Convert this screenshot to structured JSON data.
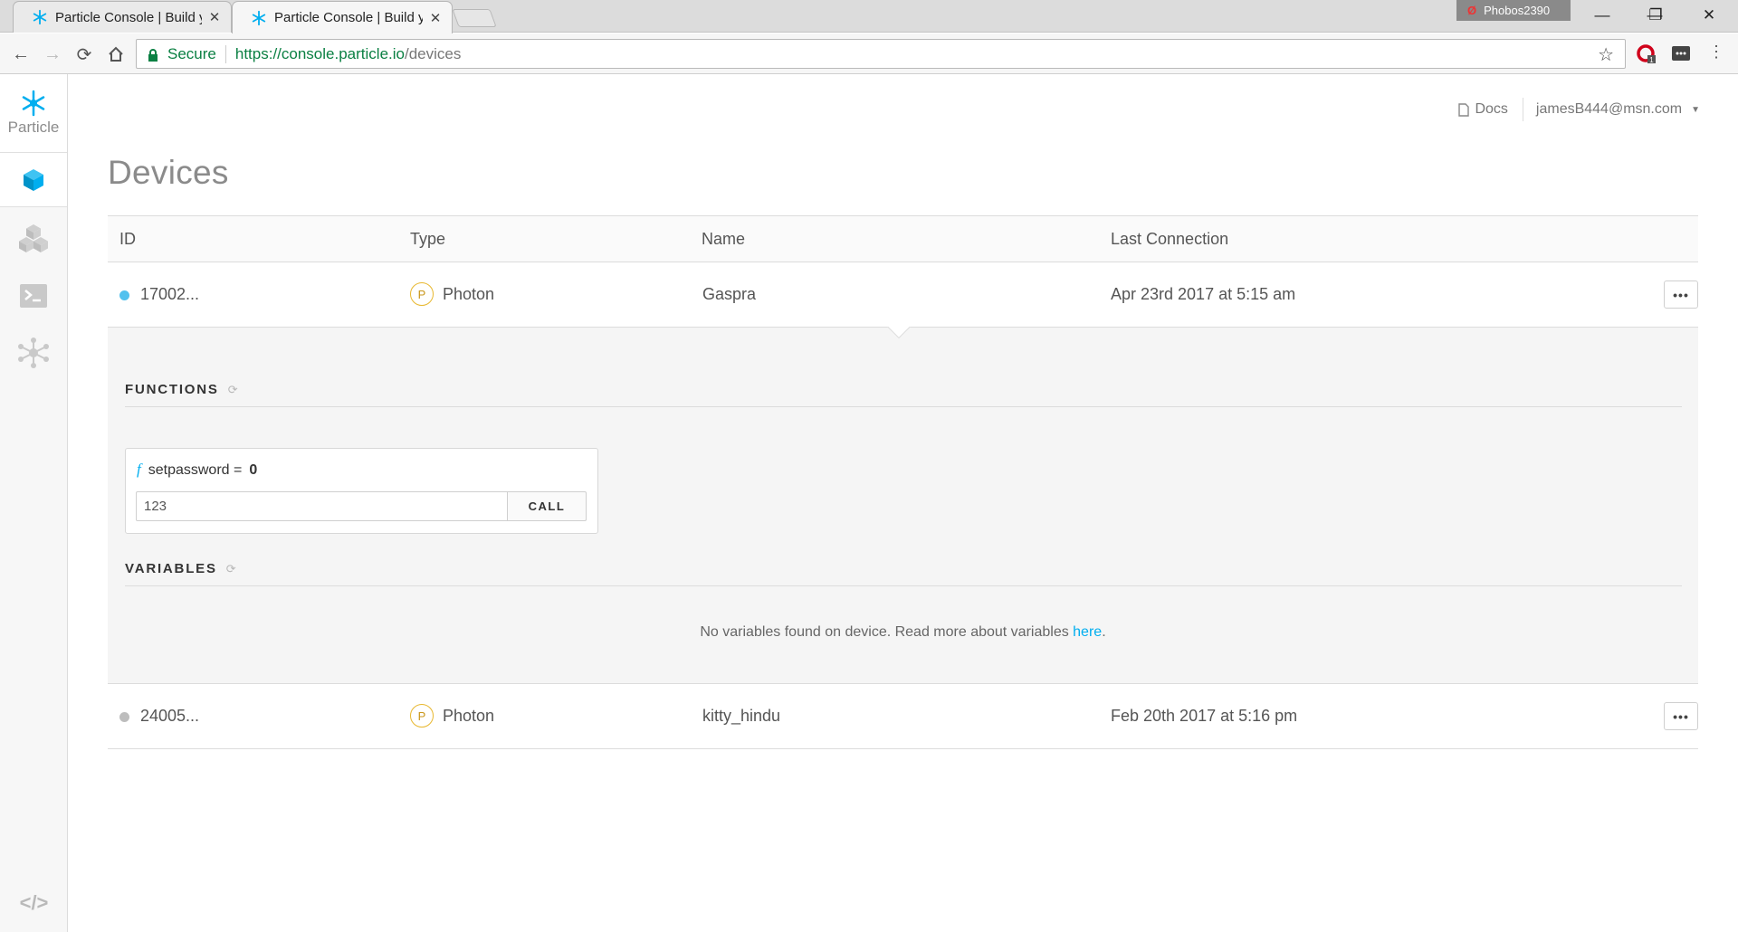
{
  "browser": {
    "tabs": [
      {
        "title": "Particle Console | Build y",
        "active": false
      },
      {
        "title": "Particle Console | Build y",
        "active": true
      }
    ],
    "profile_name": "Phobos2390",
    "profile_icon": "Ø",
    "secure_label": "Secure",
    "url_host": "https://console.particle.io",
    "url_path": "/devices",
    "window_controls": {
      "minimize": "—",
      "restore": "❐",
      "close": "✕"
    }
  },
  "sidebar": {
    "brand": "Particle",
    "items": [
      "devices",
      "products",
      "console",
      "mesh"
    ],
    "bottom": "</>"
  },
  "header": {
    "docs_label": "Docs",
    "user_email": "jamesB444@msn.com"
  },
  "page": {
    "title": "Devices"
  },
  "table": {
    "columns": [
      "ID",
      "Type",
      "Name",
      "Last Connection"
    ],
    "rows": [
      {
        "id": "17002...",
        "type_badge": "P",
        "type": "Photon",
        "name": "Gaspra",
        "last_connection": "Apr 23rd 2017 at 5:15 am",
        "status_color": "#52c1ee"
      },
      {
        "id": "24005...",
        "type_badge": "P",
        "type": "Photon",
        "name": "kitty_hindu",
        "last_connection": "Feb 20th 2017 at 5:16 pm",
        "status_color": "#bdbdbd"
      }
    ],
    "more_label": "•••"
  },
  "details": {
    "functions_heading": "FUNCTIONS",
    "function_prefix": "f",
    "function_name": "setpassword =",
    "function_result": "0",
    "function_arg": "123",
    "call_label": "CALL",
    "variables_heading": "VARIABLES",
    "no_variables_text": "No variables found on device. Read more about variables ",
    "no_variables_link": "here",
    "no_variables_end": "."
  },
  "colors": {
    "accent": "#00aeef",
    "secure_green": "#0b8043",
    "badge_yellow": "#e8b830"
  }
}
